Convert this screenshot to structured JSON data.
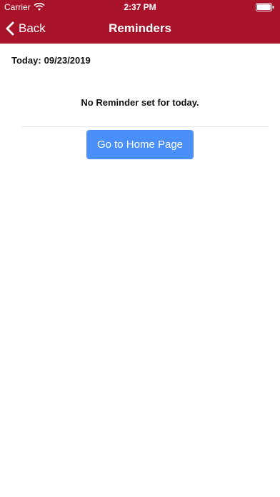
{
  "status_bar": {
    "carrier": "Carrier",
    "time": "2:37 PM",
    "wifi_icon": "wifi-icon",
    "battery_icon": "battery-icon"
  },
  "nav": {
    "back_label": "Back",
    "back_icon": "chevron-left-icon",
    "title": "Reminders"
  },
  "content": {
    "today_label": "Today:",
    "today_date": "09/23/2019",
    "empty_message": "No Reminder set for today.",
    "home_button_label": "Go to Home Page"
  },
  "colors": {
    "header_background": "#a8132a",
    "button_background": "#4a8ef7"
  }
}
